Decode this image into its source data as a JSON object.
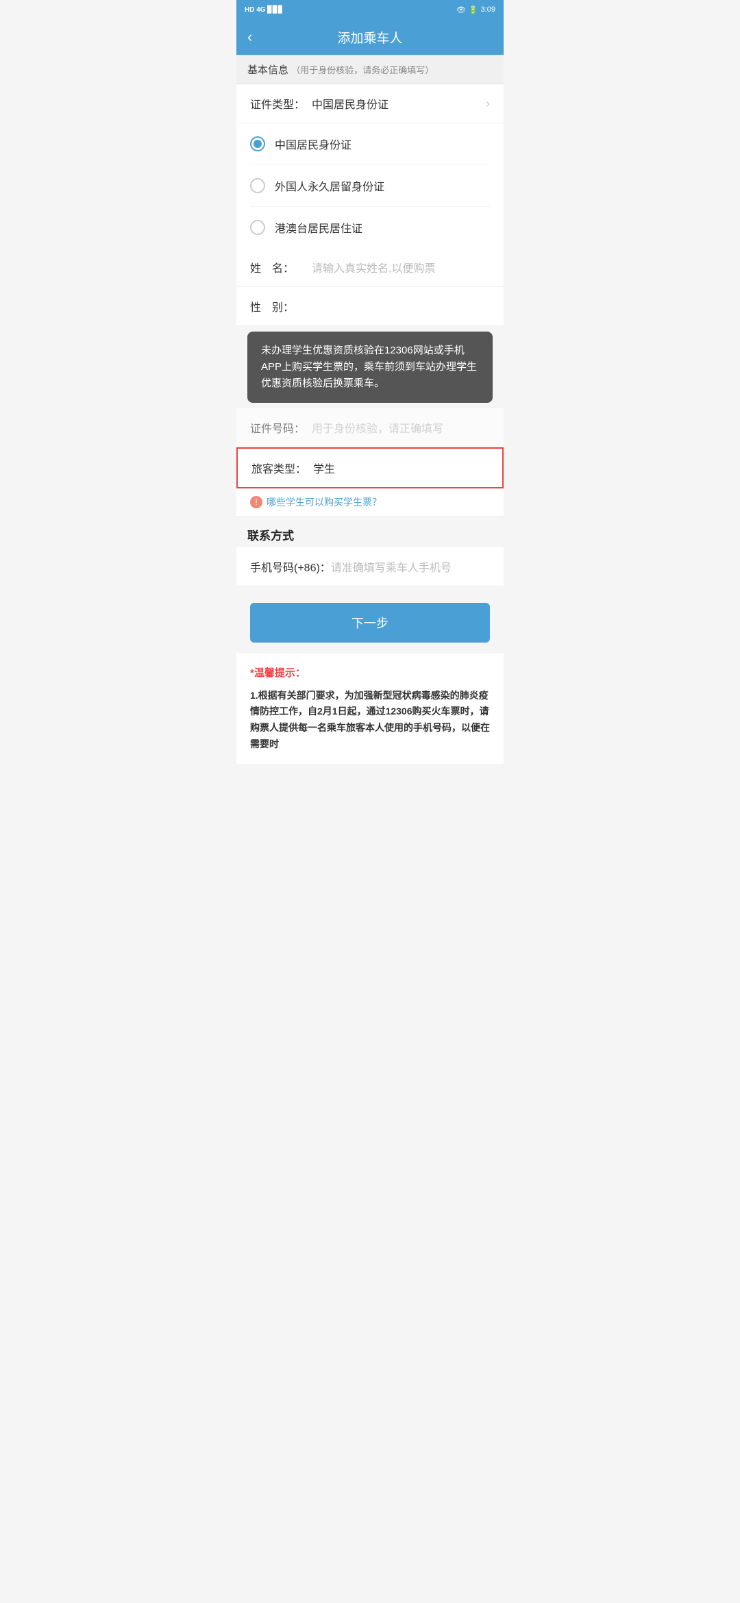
{
  "statusBar": {
    "left": "HD 4G 46",
    "time": "3:09",
    "battery": "45"
  },
  "navBar": {
    "backLabel": "‹",
    "title": "添加乘车人"
  },
  "basicInfo": {
    "sectionLabel": "基本信息",
    "sectionNote": "（用于身份核验，请务必正确填写）",
    "idTypeLabel": "证件类型：",
    "idTypeValue": "中国居民身份证",
    "radioOptions": [
      {
        "label": "中国居民身份证",
        "selected": true
      },
      {
        "label": "外国人永久居留身份证",
        "selected": false
      },
      {
        "label": "港澳台居民居住证",
        "selected": false
      }
    ],
    "nameLabel": "姓　名：",
    "namePlaceholder": "请输入真实姓名,以便购票",
    "genderLabel": "性　别：",
    "idNumberLabel": "证件号码：",
    "idNumberPlaceholder": "用于身份核验，请正确填写"
  },
  "tooltip": {
    "text": "未办理学生优惠资质核验在12306网站或手机APP上购买学生票的，乘车前须到车站办理学生优惠资质核验后换票乘车。"
  },
  "passengerType": {
    "label": "旅客类型：",
    "value": "学生"
  },
  "infoLink": {
    "icon": "!",
    "text": "哪些学生可以购买学生票？"
  },
  "contactSection": {
    "title": "联系方式",
    "phoneLabel": "手机号码(+86)：",
    "phonePlaceholder": "请准确填写乘车人手机号"
  },
  "nextButton": {
    "label": "下一步"
  },
  "tips": {
    "title": "*温馨提示：",
    "content": "1.根据有关部门要求，为加强新型冠状病毒感染的肺炎疫情防控工作，自2月1日起，通过12306购买火车票时，请购票人提供每一名乘车旅客本人使用的手机号码，以便在需要时"
  }
}
